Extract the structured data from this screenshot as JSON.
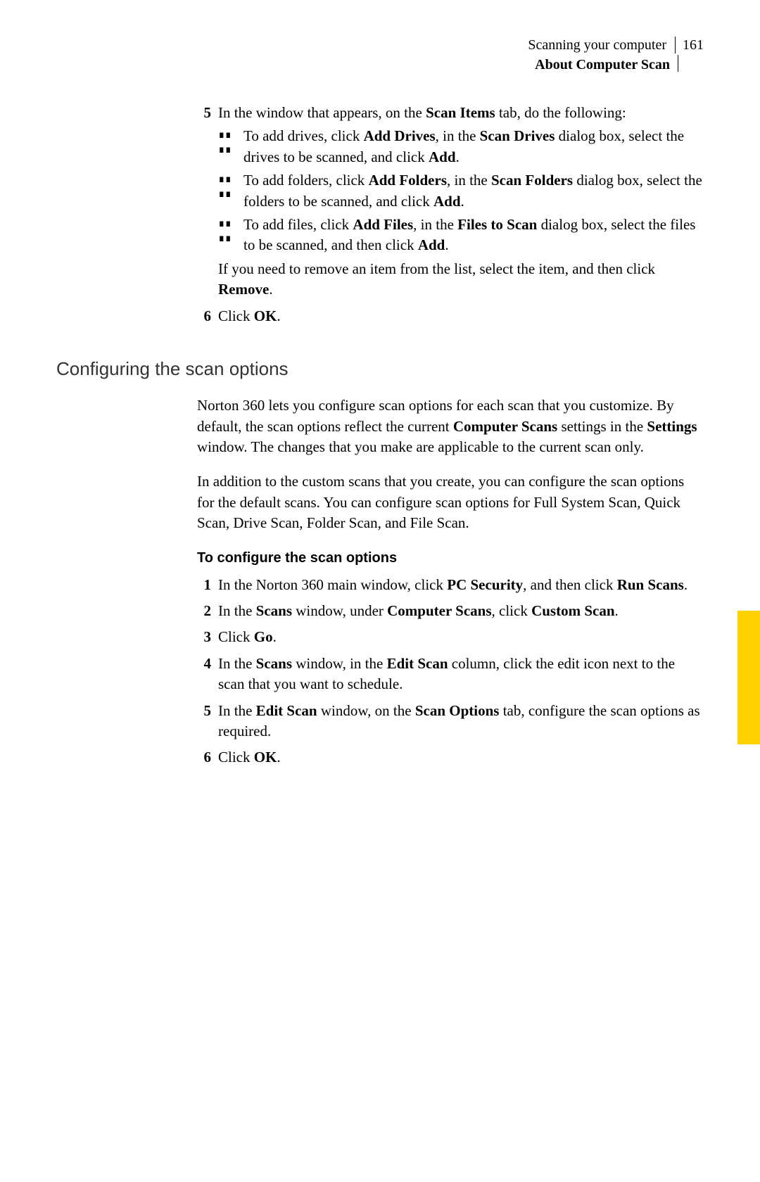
{
  "header": {
    "chapter": "Scanning your computer",
    "page": "161",
    "section": "About Computer Scan"
  },
  "step5": {
    "num": "5",
    "intro1": "In the window that appears, on the ",
    "intro_b1": "Scan Items",
    "intro2": " tab, do the following:",
    "b1": {
      "t1": "To add drives, click ",
      "b1": "Add Drives",
      "t2": ", in the ",
      "b2": "Scan Drives",
      "t3": " dialog box, select the drives to be scanned, and click ",
      "b3": "Add",
      "t4": "."
    },
    "b2": {
      "t1": "To add folders, click ",
      "b1": "Add Folders",
      "t2": ", in the ",
      "b2": "Scan Folders",
      "t3": " dialog box, select the folders to be scanned, and click ",
      "b3": "Add",
      "t4": "."
    },
    "b3": {
      "t1": "To add files, click ",
      "b1": "Add Files",
      "t2": ", in the ",
      "b2": "Files to Scan",
      "t3": " dialog box, select the files to be scanned, and then click ",
      "b3": "Add",
      "t4": "."
    },
    "note1": "If you need to remove an item from the list, select the item, and then click ",
    "note_b": "Remove",
    "note2": "."
  },
  "step6": {
    "num": "6",
    "t1": "Click ",
    "b1": "OK",
    "t2": "."
  },
  "heading": "Configuring the scan options",
  "para1": {
    "t1": "Norton 360 lets you configure scan options for each scan that you customize. By default, the scan options reflect the current ",
    "b1": "Computer Scans",
    "t2": " settings in the ",
    "b2": "Settings",
    "t3": " window. The changes that you make are applicable to the current scan only."
  },
  "para2": "In addition to the custom scans that you create, you can configure the scan options for the default scans. You can configure scan options for Full System Scan, Quick Scan, Drive Scan, Folder Scan, and File Scan.",
  "subheading": "To configure the scan options",
  "s1": {
    "num": "1",
    "t1": "In the Norton 360 main window, click ",
    "b1": "PC Security",
    "t2": ", and then click ",
    "b2": "Run Scans",
    "t3": "."
  },
  "s2": {
    "num": "2",
    "t1": "In the ",
    "b1": "Scans",
    "t2": " window, under ",
    "b2": "Computer Scans",
    "t3": ", click ",
    "b3": "Custom Scan",
    "t4": "."
  },
  "s3": {
    "num": "3",
    "t1": "Click ",
    "b1": "Go",
    "t2": "."
  },
  "s4": {
    "num": "4",
    "t1": "In the ",
    "b1": "Scans",
    "t2": " window, in the ",
    "b2": "Edit Scan",
    "t3": " column, click the edit icon next to the scan that you want to schedule."
  },
  "s5": {
    "num": "5",
    "t1": "In the ",
    "b1": "Edit Scan",
    "t2": " window, on the ",
    "b2": "Scan Options",
    "t3": " tab, configure the scan options as required."
  },
  "s6": {
    "num": "6",
    "t1": "Click ",
    "b1": "OK",
    "t2": "."
  }
}
